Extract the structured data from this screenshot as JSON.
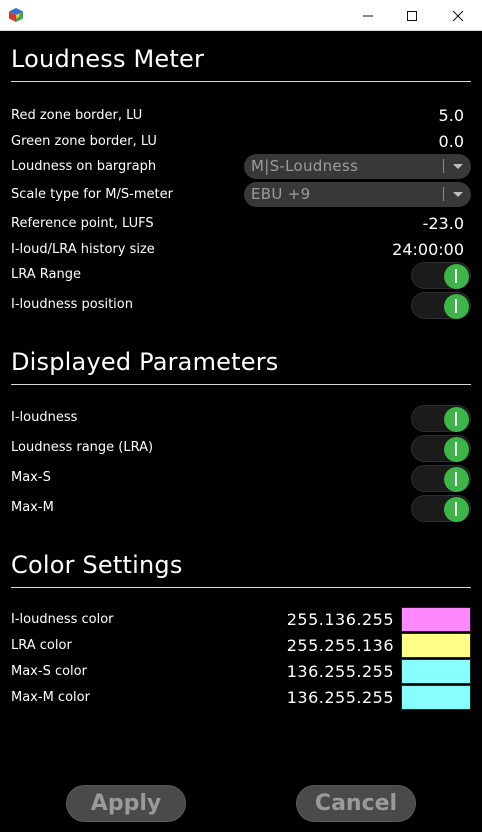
{
  "window": {
    "minimize_label": "",
    "maximize_label": "",
    "close_label": ""
  },
  "sections": {
    "loudness_meter": "Loudness Meter",
    "displayed_parameters": "Displayed Parameters",
    "color_settings": "Color Settings"
  },
  "loudness": {
    "red_zone_label": "Red zone border, LU",
    "red_zone_value": "5.0",
    "green_zone_label": "Green zone border, LU",
    "green_zone_value": "0.0",
    "bargraph_label": "Loudness on bargraph",
    "bargraph_value": "M|S-Loudness",
    "scale_label": "Scale type for M/S-meter",
    "scale_value": "EBU +9",
    "reference_label": "Reference point, LUFS",
    "reference_value": "-23.0",
    "history_label": "I-loud/LRA history size",
    "history_value": "24:00:00",
    "lra_range_label": "LRA Range",
    "lra_range_on": true,
    "iloud_position_label": "I-loudness position",
    "iloud_position_on": true
  },
  "displayed": {
    "iloudness_label": "I-loudness",
    "lra_label": "Loudness range (LRA)",
    "maxs_label": "Max-S",
    "maxm_label": "Max-M"
  },
  "colors": {
    "iloud_label": "I-loudness color",
    "iloud_value": "255.136.255",
    "iloud_hex": "#ff88ff",
    "lra_label": "LRA color",
    "lra_value": "255.255.136",
    "lra_hex": "#ffff88",
    "maxs_label": "Max-S color",
    "maxs_value": "136.255.255",
    "maxs_hex": "#88ffff",
    "maxm_label": "Max-M color",
    "maxm_value": "136.255.255",
    "maxm_hex": "#88ffff"
  },
  "buttons": {
    "apply": "Apply",
    "cancel": "Cancel"
  },
  "accent": {
    "toggle_on": "#3db548"
  }
}
